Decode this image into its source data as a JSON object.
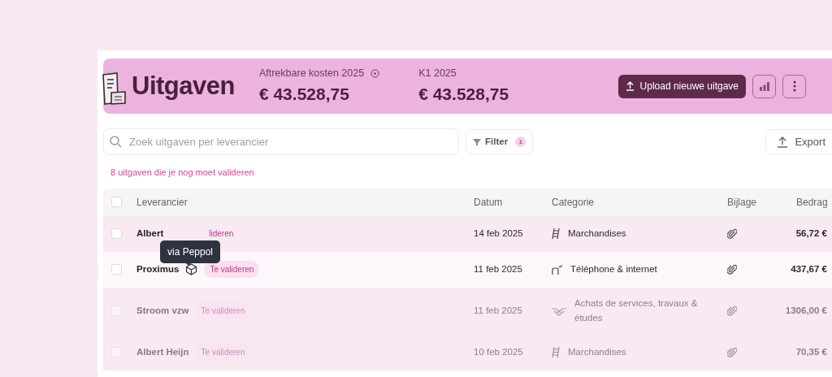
{
  "header": {
    "title": "Uitgaven",
    "stats": [
      {
        "label": "Aftrekbare kosten 2025",
        "info": true,
        "value": "€ 43.528,75"
      },
      {
        "label": "K1 2025",
        "value": "€ 43.528,75"
      }
    ],
    "upload_button": "Upload nieuwe uitgave"
  },
  "toolbar": {
    "search": {
      "placeholder": "Zoek uitgaven per leverancier"
    },
    "filter": {
      "label": "Filter",
      "count": "1"
    },
    "export": "Export"
  },
  "notice": "8 uitgaven die je nog moet valideren",
  "table": {
    "all_checked": false,
    "columns": [
      "Leverancier",
      "Datum",
      "Categorie",
      "Bijlage",
      "Bedrag"
    ],
    "rows": [
      {
        "checked": false,
        "supplier": "Albert",
        "peppol": false,
        "badge": "lideren",
        "date": "14 feb 2025",
        "category": {
          "kind": "goods",
          "text": "Marchandises"
        },
        "attachment": true,
        "amount": "56,72 €",
        "highlighted": false,
        "dimmed": false
      },
      {
        "checked": false,
        "supplier": "Proximus",
        "peppol": true,
        "badge": "Te valideren",
        "date": "11 feb 2025",
        "category": {
          "kind": "phone",
          "text": "Téléphone & internet"
        },
        "attachment": true,
        "amount": "437,67 €",
        "highlighted": true,
        "dimmed": false
      },
      {
        "checked": false,
        "supplier": "Stroom vzw",
        "peppol": false,
        "badge": "Te valideren",
        "date": "11 feb 2025",
        "category": {
          "kind": "services",
          "text": "Achats de services, travaux & études"
        },
        "attachment": true,
        "amount": "1306,00 €",
        "highlighted": false,
        "dimmed": true
      },
      {
        "checked": false,
        "supplier": "Albert Heijn",
        "peppol": false,
        "badge": "Te valideren",
        "date": "10 feb 2025",
        "category": {
          "kind": "goods",
          "text": "Marchandises"
        },
        "attachment": true,
        "amount": "70,35 €",
        "highlighted": false,
        "dimmed": true
      }
    ]
  },
  "tooltip": {
    "text": "via Peppol"
  }
}
